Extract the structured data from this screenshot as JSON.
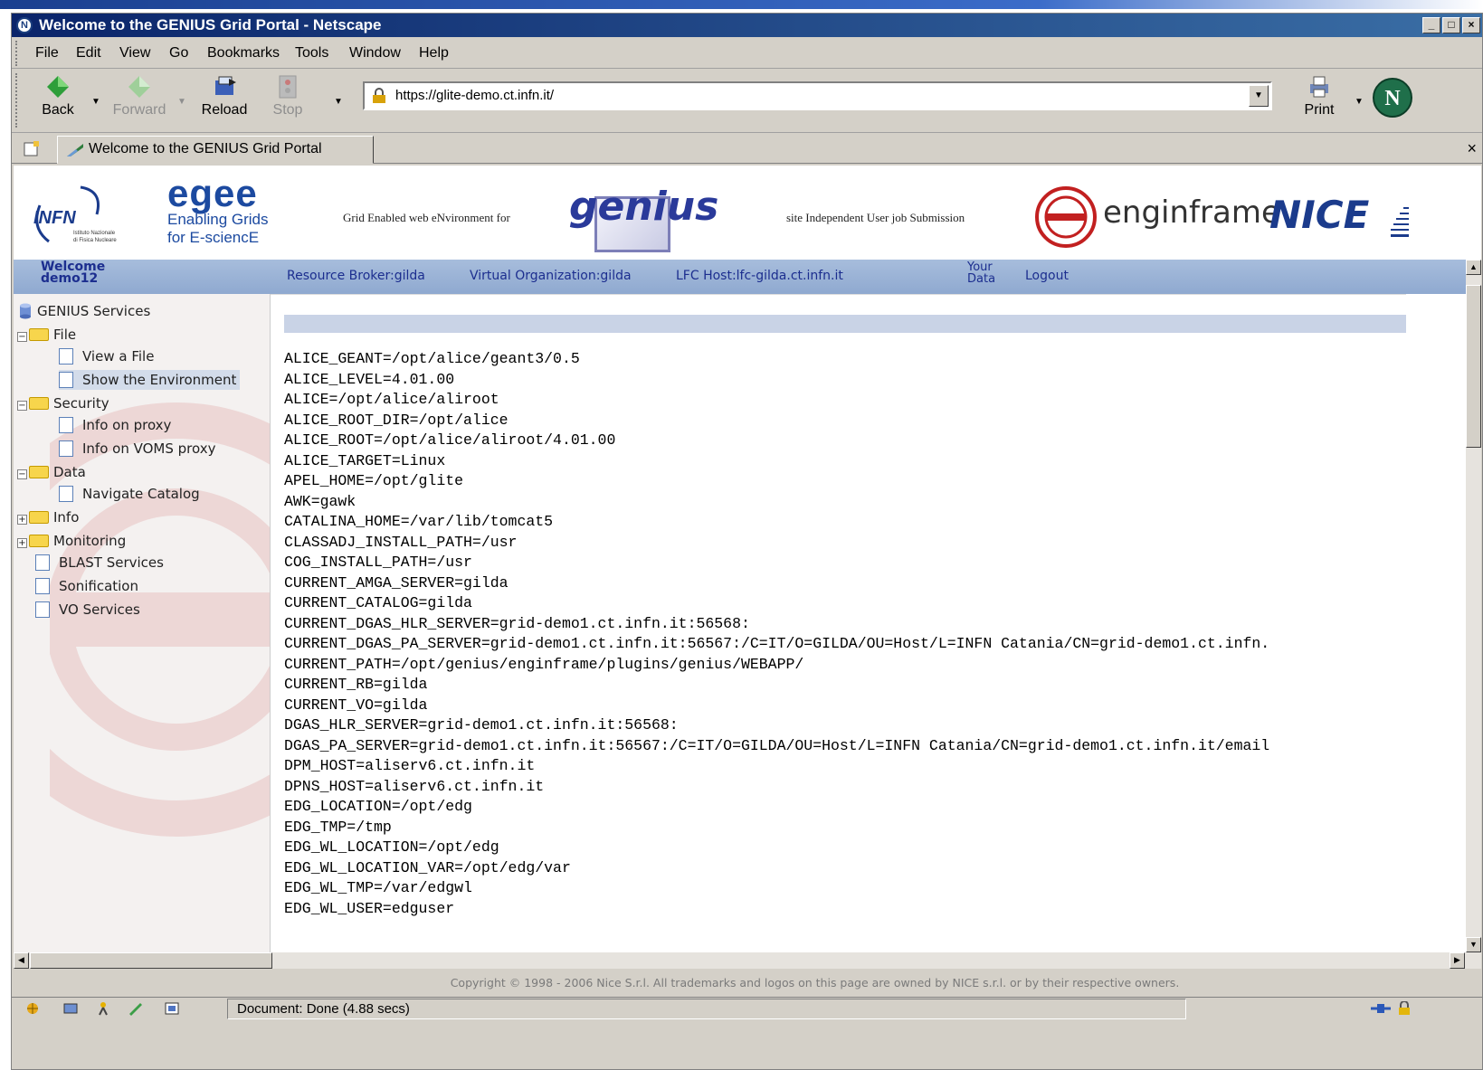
{
  "window": {
    "title": "Welcome to the GENIUS Grid Portal - Netscape",
    "app_icon_letter": "N"
  },
  "menu": {
    "items": [
      "File",
      "Edit",
      "View",
      "Go",
      "Bookmarks",
      "Tools",
      "Window",
      "Help"
    ]
  },
  "navigation": {
    "back_label": "Back",
    "forward_label": "Forward",
    "reload_label": "Reload",
    "stop_label": "Stop",
    "print_label": "Print",
    "url": "https://glite-demo.ct.infn.it/"
  },
  "tab": {
    "label": "Welcome to the GENIUS Grid Portal",
    "close": "×"
  },
  "banner": {
    "infn_text": "INFN",
    "infn_subtext": "Istituto Nazionale\ndi Fisica Nucleare",
    "egee_logo": "egee",
    "egee_line1": "Enabling Grids",
    "egee_line2": "for E-sciencE",
    "genius_tagline": "Grid Enabled web eNvironment for",
    "genius_logo": "genius",
    "siuss_tagline": "site Independent User job Submission",
    "enginframe_logo": "enginframe",
    "nice_logo": "NICE"
  },
  "userbar": {
    "welcome_line1": "Welcome",
    "welcome_line2": "demo12",
    "resource_broker": "Resource Broker:gilda",
    "virtual_org": "Virtual Organization:gilda",
    "lfc_host": "LFC Host:lfc-gilda.ct.infn.it",
    "your_data_line1": "Your",
    "your_data_line2": "Data",
    "logout": "Logout"
  },
  "tree": {
    "root": "GENIUS Services",
    "file": "File",
    "view_file": "View a File",
    "show_env": "Show the Environment",
    "security": "Security",
    "info_proxy": "Info on proxy",
    "info_voms": "Info on VOMS proxy",
    "data": "Data",
    "navigate_catalog": "Navigate Catalog",
    "info": "Info",
    "monitoring": "Monitoring",
    "blast": "BLAST Services",
    "sonification": "Sonification",
    "vo_services": "VO Services"
  },
  "environment": [
    "ALICE_GEANT=/opt/alice/geant3/0.5",
    "ALICE_LEVEL=4.01.00",
    "ALICE=/opt/alice/aliroot",
    "ALICE_ROOT_DIR=/opt/alice",
    "ALICE_ROOT=/opt/alice/aliroot/4.01.00",
    "ALICE_TARGET=Linux",
    "APEL_HOME=/opt/glite",
    "AWK=gawk",
    "CATALINA_HOME=/var/lib/tomcat5",
    "CLASSADJ_INSTALL_PATH=/usr",
    "COG_INSTALL_PATH=/usr",
    "CURRENT_AMGA_SERVER=gilda",
    "CURRENT_CATALOG=gilda",
    "CURRENT_DGAS_HLR_SERVER=grid-demo1.ct.infn.it:56568:",
    "CURRENT_DGAS_PA_SERVER=grid-demo1.ct.infn.it:56567:/C=IT/O=GILDA/OU=Host/L=INFN Catania/CN=grid-demo1.ct.infn.",
    "CURRENT_PATH=/opt/genius/enginframe/plugins/genius/WEBAPP/",
    "CURRENT_RB=gilda",
    "CURRENT_VO=gilda",
    "DGAS_HLR_SERVER=grid-demo1.ct.infn.it:56568:",
    "DGAS_PA_SERVER=grid-demo1.ct.infn.it:56567:/C=IT/O=GILDA/OU=Host/L=INFN Catania/CN=grid-demo1.ct.infn.it/email",
    "DPM_HOST=aliserv6.ct.infn.it",
    "DPNS_HOST=aliserv6.ct.infn.it",
    "EDG_LOCATION=/opt/edg",
    "EDG_TMP=/tmp",
    "EDG_WL_LOCATION=/opt/edg",
    "EDG_WL_LOCATION_VAR=/opt/edg/var",
    "EDG_WL_TMP=/var/edgwl",
    "EDG_WL_USER=edguser"
  ],
  "footer": {
    "copyright": "Copyright © 1998 - 2006 Nice S.r.l. All trademarks and logos on this page are owned by NICE s.r.l. or by their respective owners."
  },
  "status": {
    "text": "Document: Done (4.88 secs)"
  },
  "colors": {
    "title_bar": "#0a246a",
    "userbar": "#9bb3d6",
    "link_text": "#1c2e8f",
    "egee_orange": "#f07f1a",
    "genius_blue": "#2a3a9a"
  }
}
